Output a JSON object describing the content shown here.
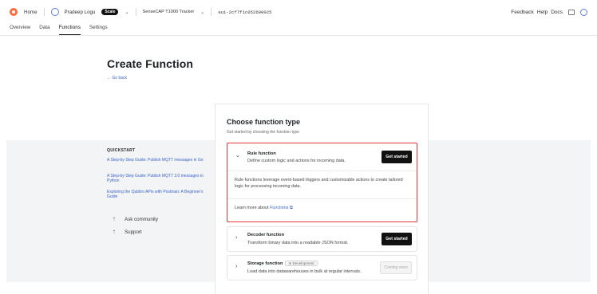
{
  "topbar": {
    "home_label": "Home",
    "org_name": "Pradeep Logu",
    "plan_badge": "Scale",
    "project_name": "SenseCAP T1000 Tracker",
    "device_id": "eui-2cf7f1c052600025",
    "right_links": [
      "Feedback",
      "Help",
      "Docs"
    ]
  },
  "tabs": [
    "Overview",
    "Data",
    "Functions",
    "Settings"
  ],
  "active_tab": "Functions",
  "header": {
    "title": "Create Function",
    "back_label": "← Go back"
  },
  "sidebar": {
    "quickstart_heading": "QUICKSTART",
    "links": [
      "A Step-by-Step Guide: Publish MQTT messages in Go",
      "A Step-by-Step Guide: Publish MQTT 3.0 messages in Python",
      "Exploring the Qubitro APIs with Postman: A Beginner's Guide"
    ],
    "items": [
      {
        "icon": "external-link-icon",
        "label": "Ask community"
      },
      {
        "icon": "external-link-icon",
        "label": "Support"
      }
    ]
  },
  "panel": {
    "title": "Choose function type",
    "subtitle": "Get started by choosing the function type",
    "cards": [
      {
        "title": "Rule function",
        "description": "Define custom logic and actions for incoming data.",
        "button": "Get started",
        "expanded": true,
        "body": "Rule functions leverage event-based triggers and customizable actions to create tailored logic for processing incoming data.",
        "learn_prefix": "Learn more about",
        "learn_link": "Functions",
        "highlight_color": "#e5343c"
      },
      {
        "title": "Decoder function",
        "description": "Transform binary data into a readable JSON format.",
        "button": "Get started"
      },
      {
        "title": "Storage function",
        "badge": "In Development",
        "description": "Load data into datawarehouses in bulk at regular intervals.",
        "button": "Coming soon"
      }
    ]
  },
  "colors": {
    "accent_link": "#3b63c9",
    "primary_button": "#111111",
    "highlight": "#e5343c",
    "logo": "#ff6a3d"
  }
}
